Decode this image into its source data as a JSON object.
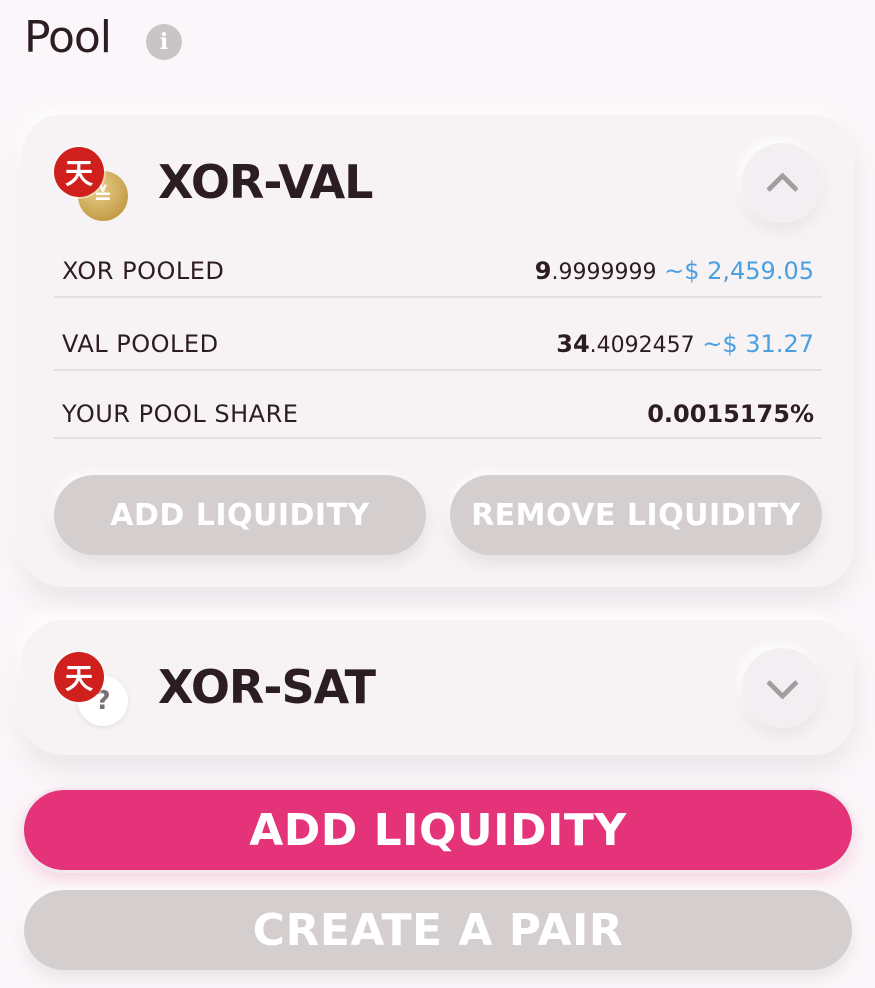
{
  "header": {
    "title": "Pool",
    "info_icon": "info-icon"
  },
  "pools": [
    {
      "pair": "XOR-VAL",
      "token_a_icon": "天",
      "token_b_icon": "≚",
      "expanded": true,
      "toggle_icon": "chevron-up-icon",
      "rows": [
        {
          "label": "XOR POOLED",
          "int": "9",
          "dec": ".9999999",
          "usd": "~$ 2,459.05"
        },
        {
          "label": "VAL POOLED",
          "int": "34",
          "dec": ".4092457",
          "usd": "~$ 31.27"
        },
        {
          "label": "YOUR POOL SHARE",
          "value": "0.0015175%"
        }
      ],
      "add_label": "ADD LIQUIDITY",
      "remove_label": "REMOVE LIQUIDITY"
    },
    {
      "pair": "XOR-SAT",
      "token_a_icon": "天",
      "token_b_icon": "?",
      "expanded": false,
      "toggle_icon": "chevron-down-icon"
    }
  ],
  "actions": {
    "add_liquidity": "ADD LIQUIDITY",
    "create_pair": "CREATE A PAIR"
  },
  "colors": {
    "accent": "#e5337a",
    "usd_blue": "#4a9fe0",
    "disabled_button": "#d4cecf",
    "xor_red": "#d0201e"
  }
}
